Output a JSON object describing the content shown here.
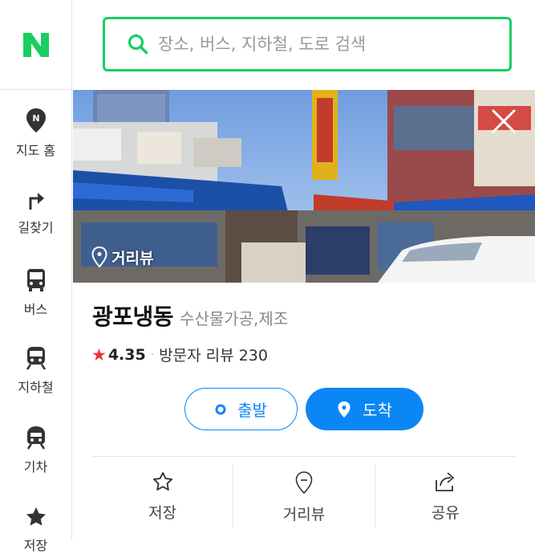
{
  "sidebar": {
    "logo": "N",
    "items": [
      {
        "label": "지도 홈",
        "icon": "map-pin-icon"
      },
      {
        "label": "길찾기",
        "icon": "directions-icon"
      },
      {
        "label": "버스",
        "icon": "bus-icon"
      },
      {
        "label": "지하철",
        "icon": "subway-icon"
      },
      {
        "label": "기차",
        "icon": "train-icon"
      },
      {
        "label": "저장",
        "icon": "star-icon"
      }
    ]
  },
  "search": {
    "placeholder": "장소, 버스, 지하철, 도로 검색",
    "icon": "search-icon"
  },
  "streetview": {
    "badge_label": "거리뷰",
    "close_icon": "close-icon"
  },
  "place": {
    "name": "광포냉동",
    "category": "수산물가공,제조",
    "rating": "4.35",
    "reviews_label": "방문자 리뷰",
    "reviews_count": "230"
  },
  "buttons": {
    "start_label": "출발",
    "arrive_label": "도착"
  },
  "actions": [
    {
      "label": "저장",
      "icon": "star-outline-icon"
    },
    {
      "label": "거리뷰",
      "icon": "pin-outline-icon"
    },
    {
      "label": "공유",
      "icon": "share-icon"
    }
  ],
  "colors": {
    "brand_green": "#19ce60",
    "accent_blue": "#0a87f5",
    "rating_red": "#e8343e"
  }
}
